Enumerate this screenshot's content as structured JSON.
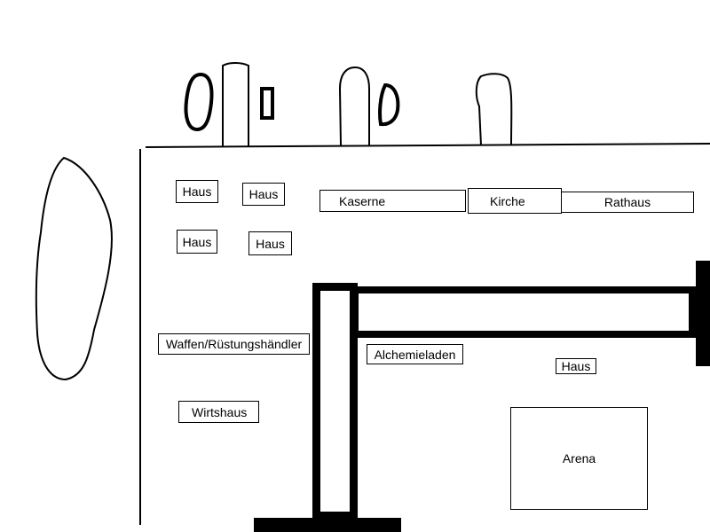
{
  "map": {
    "buildings": {
      "haus_1": "Haus",
      "haus_2": "Haus",
      "haus_3": "Haus",
      "haus_4": "Haus",
      "kaserne": "Kaserne",
      "kirche": "Kirche",
      "rathaus": "Rathaus",
      "waffenhaendler": "Waffen/Rüstungshändler",
      "alchemieladen": "Alchemieladen",
      "haus_5": "Haus",
      "wirtshaus": "Wirtshaus",
      "arena": "Arena"
    }
  }
}
